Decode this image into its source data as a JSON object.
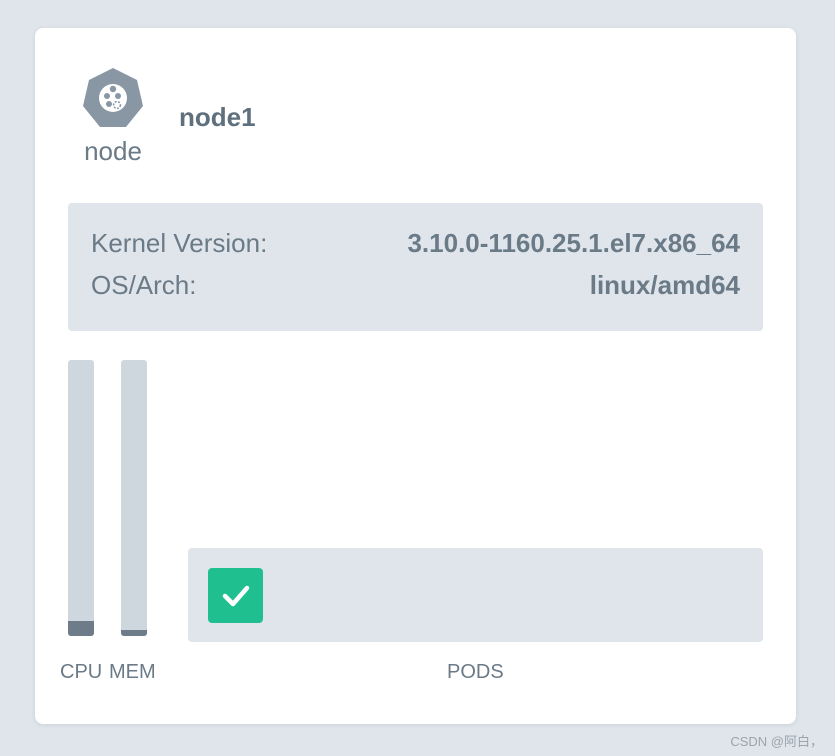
{
  "node": {
    "icon": "kubernetes-node-icon",
    "kind_label": "node",
    "name": "node1"
  },
  "info": {
    "kernel_label": "Kernel Version:",
    "kernel_value": "3.10.0-1160.25.1.el7.x86_64",
    "os_label": "OS/Arch:",
    "os_value": "linux/amd64"
  },
  "usage": {
    "cpu_label": "CPU",
    "mem_label": "MEM",
    "cpu_fraction": 0.055,
    "mem_fraction": 0.022
  },
  "pods": {
    "label": "PODS",
    "items": [
      {
        "status": "ok",
        "icon": "check-icon"
      }
    ]
  },
  "colors": {
    "page_bg": "#dfe5eb",
    "card_bg": "#ffffff",
    "text": "#6b7a87",
    "bar_track": "#cfd7de",
    "bar_fill": "#6e7c89",
    "pod_ok": "#1fbf8f"
  },
  "watermark": "CSDN @阿白，"
}
